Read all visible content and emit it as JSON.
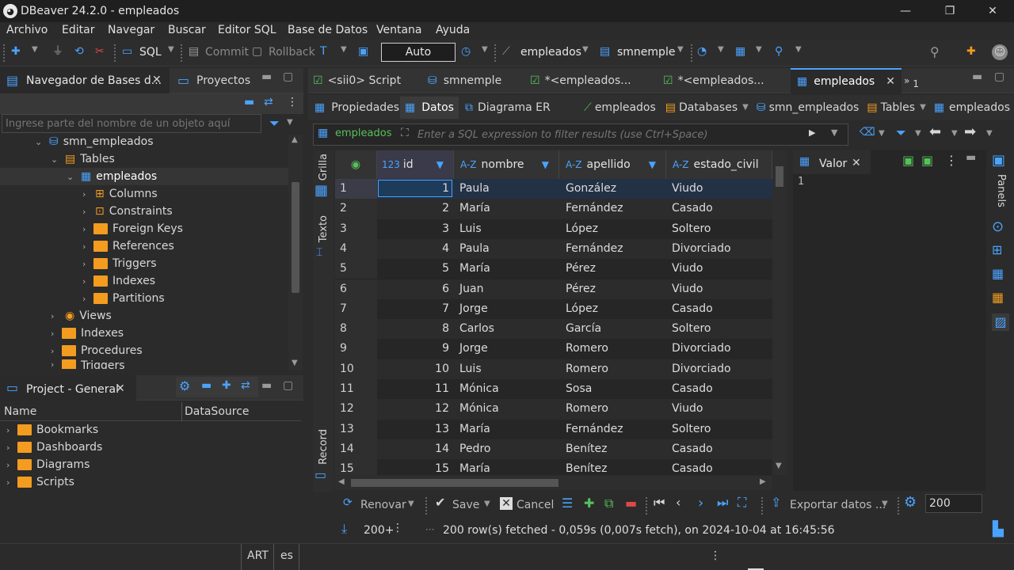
{
  "window": {
    "title": "DBeaver 24.2.0 - empleados",
    "controls": [
      "minimize-icon",
      "restore-icon",
      "close-icon"
    ]
  },
  "menu": [
    "Archivo",
    "Editar",
    "Navegar",
    "Buscar",
    "Editor SQL",
    "Base de Datos",
    "Ventana",
    "Ayuda"
  ],
  "toolbar": {
    "sql_label": "SQL",
    "commit_label": "Commit",
    "rollback_label": "Rollback",
    "txn_mode": "Auto",
    "datasource": "empleados",
    "schema": "smnemple"
  },
  "navigator": {
    "tab_label": "Navegador de Bases d...",
    "projects_tab": "Proyectos",
    "filter_placeholder": "Ingrese parte del nombre de un objeto aquí",
    "tree": {
      "root": "smn_empleados",
      "tables": "Tables",
      "table": "empleados",
      "children": [
        "Columns",
        "Constraints",
        "Foreign Keys",
        "References",
        "Triggers",
        "Indexes",
        "Partitions"
      ],
      "after": [
        "Views",
        "Indexes",
        "Procedures",
        "Triggers"
      ]
    }
  },
  "project": {
    "tab_label": "Project - General",
    "col_name": "Name",
    "col_datasource": "DataSource",
    "items": [
      "Bookmarks",
      "Dashboards",
      "Diagrams",
      "Scripts"
    ]
  },
  "editor_tabs": [
    "<sii0> Script",
    "smnemple",
    "*<empleados...",
    "*<empleados...",
    "empleados",
    "1"
  ],
  "sub_tabs": {
    "properties": "Propiedades",
    "data": "Datos",
    "er": "Diagrama ER",
    "crumbs": [
      "empleados",
      "Databases",
      "smn_empleados",
      "Tables",
      "empleados"
    ]
  },
  "filter": {
    "table": "empleados",
    "placeholder": "Enter a SQL expression to filter results (use Ctrl+Space)"
  },
  "side_tabs": {
    "grid": "Grilla",
    "text": "Texto",
    "record": "Record",
    "panels": "Panels"
  },
  "grid": {
    "columns": [
      {
        "type": "123",
        "name": "id"
      },
      {
        "type": "A-Z",
        "name": "nombre"
      },
      {
        "type": "A-Z",
        "name": "apellido"
      },
      {
        "type": "A-Z",
        "name": "estado_civil"
      }
    ],
    "rows": [
      [
        "1",
        "1",
        "Paula",
        "González",
        "Viudo"
      ],
      [
        "2",
        "2",
        "María",
        "Fernández",
        "Casado"
      ],
      [
        "3",
        "3",
        "Luis",
        "López",
        "Soltero"
      ],
      [
        "4",
        "4",
        "Paula",
        "Fernández",
        "Divorciado"
      ],
      [
        "5",
        "5",
        "María",
        "Pérez",
        "Viudo"
      ],
      [
        "6",
        "6",
        "Juan",
        "Pérez",
        "Viudo"
      ],
      [
        "7",
        "7",
        "Jorge",
        "López",
        "Casado"
      ],
      [
        "8",
        "8",
        "Carlos",
        "García",
        "Soltero"
      ],
      [
        "9",
        "9",
        "Jorge",
        "Romero",
        "Divorciado"
      ],
      [
        "10",
        "10",
        "Luis",
        "Romero",
        "Divorciado"
      ],
      [
        "11",
        "11",
        "Mónica",
        "Sosa",
        "Casado"
      ],
      [
        "12",
        "12",
        "Mónica",
        "Romero",
        "Viudo"
      ],
      [
        "13",
        "13",
        "María",
        "Fernández",
        "Soltero"
      ],
      [
        "14",
        "14",
        "Pedro",
        "Benítez",
        "Casado"
      ],
      [
        "15",
        "15",
        "María",
        "Benítez",
        "Casado"
      ]
    ]
  },
  "value_panel": {
    "title": "Valor",
    "value": "1"
  },
  "actions": {
    "revert": "Renovar",
    "save": "Save",
    "cancel": "Cancel",
    "export": "Exportar datos ...",
    "fetch_size": "200",
    "rows_count": "200+",
    "status": "200 row(s) fetched - 0,059s (0,007s fetch), on 2024-10-04 at 16:45:56"
  },
  "statusbar": {
    "tz": "ART",
    "locale": "es"
  }
}
